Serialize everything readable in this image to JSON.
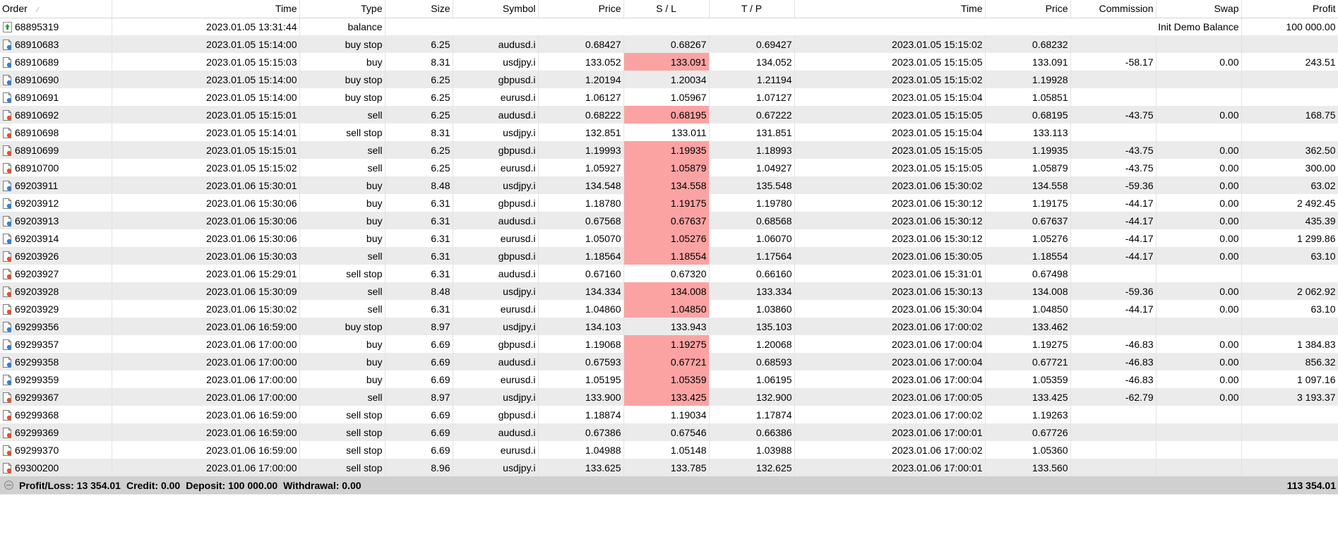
{
  "columns": [
    "Order",
    "Time",
    "Type",
    "Size",
    "Symbol",
    "Price",
    "S / L",
    "T / P",
    "Time",
    "Price",
    "Commission",
    "Swap",
    "Profit"
  ],
  "balance_row": {
    "order": "68895319",
    "time": "2023.01.05 13:31:44",
    "type": "balance",
    "comment": "Init Demo Balance",
    "profit": "100 000.00",
    "icon": "deposit-icon"
  },
  "rows": [
    {
      "order": "68910683",
      "time": "2023.01.05 15:14:00",
      "type": "buy stop",
      "size": "6.25",
      "symbol": "audusd.i",
      "price": "0.68427",
      "sl": "0.68267",
      "tp": "0.69427",
      "close_time": "2023.01.05 15:15:02",
      "close_price": "0.68232",
      "commission": "",
      "swap": "",
      "profit": "",
      "sl_hit": false,
      "side": "buy"
    },
    {
      "order": "68910689",
      "time": "2023.01.05 15:15:03",
      "type": "buy",
      "size": "8.31",
      "symbol": "usdjpy.i",
      "price": "133.052",
      "sl": "133.091",
      "tp": "134.052",
      "close_time": "2023.01.05 15:15:05",
      "close_price": "133.091",
      "commission": "-58.17",
      "swap": "0.00",
      "profit": "243.51",
      "sl_hit": true,
      "side": "buy"
    },
    {
      "order": "68910690",
      "time": "2023.01.05 15:14:00",
      "type": "buy stop",
      "size": "6.25",
      "symbol": "gbpusd.i",
      "price": "1.20194",
      "sl": "1.20034",
      "tp": "1.21194",
      "close_time": "2023.01.05 15:15:02",
      "close_price": "1.19928",
      "commission": "",
      "swap": "",
      "profit": "",
      "sl_hit": false,
      "side": "buy"
    },
    {
      "order": "68910691",
      "time": "2023.01.05 15:14:00",
      "type": "buy stop",
      "size": "6.25",
      "symbol": "eurusd.i",
      "price": "1.06127",
      "sl": "1.05967",
      "tp": "1.07127",
      "close_time": "2023.01.05 15:15:04",
      "close_price": "1.05851",
      "commission": "",
      "swap": "",
      "profit": "",
      "sl_hit": false,
      "side": "buy"
    },
    {
      "order": "68910692",
      "time": "2023.01.05 15:15:01",
      "type": "sell",
      "size": "6.25",
      "symbol": "audusd.i",
      "price": "0.68222",
      "sl": "0.68195",
      "tp": "0.67222",
      "close_time": "2023.01.05 15:15:05",
      "close_price": "0.68195",
      "commission": "-43.75",
      "swap": "0.00",
      "profit": "168.75",
      "sl_hit": true,
      "side": "sell"
    },
    {
      "order": "68910698",
      "time": "2023.01.05 15:14:01",
      "type": "sell stop",
      "size": "8.31",
      "symbol": "usdjpy.i",
      "price": "132.851",
      "sl": "133.011",
      "tp": "131.851",
      "close_time": "2023.01.05 15:15:04",
      "close_price": "133.113",
      "commission": "",
      "swap": "",
      "profit": "",
      "sl_hit": false,
      "side": "sell"
    },
    {
      "order": "68910699",
      "time": "2023.01.05 15:15:01",
      "type": "sell",
      "size": "6.25",
      "symbol": "gbpusd.i",
      "price": "1.19993",
      "sl": "1.19935",
      "tp": "1.18993",
      "close_time": "2023.01.05 15:15:05",
      "close_price": "1.19935",
      "commission": "-43.75",
      "swap": "0.00",
      "profit": "362.50",
      "sl_hit": true,
      "side": "sell"
    },
    {
      "order": "68910700",
      "time": "2023.01.05 15:15:02",
      "type": "sell",
      "size": "6.25",
      "symbol": "eurusd.i",
      "price": "1.05927",
      "sl": "1.05879",
      "tp": "1.04927",
      "close_time": "2023.01.05 15:15:05",
      "close_price": "1.05879",
      "commission": "-43.75",
      "swap": "0.00",
      "profit": "300.00",
      "sl_hit": true,
      "side": "sell"
    },
    {
      "order": "69203911",
      "time": "2023.01.06 15:30:01",
      "type": "buy",
      "size": "8.48",
      "symbol": "usdjpy.i",
      "price": "134.548",
      "sl": "134.558",
      "tp": "135.548",
      "close_time": "2023.01.06 15:30:02",
      "close_price": "134.558",
      "commission": "-59.36",
      "swap": "0.00",
      "profit": "63.02",
      "sl_hit": true,
      "side": "buy"
    },
    {
      "order": "69203912",
      "time": "2023.01.06 15:30:06",
      "type": "buy",
      "size": "6.31",
      "symbol": "gbpusd.i",
      "price": "1.18780",
      "sl": "1.19175",
      "tp": "1.19780",
      "close_time": "2023.01.06 15:30:12",
      "close_price": "1.19175",
      "commission": "-44.17",
      "swap": "0.00",
      "profit": "2 492.45",
      "sl_hit": true,
      "side": "buy"
    },
    {
      "order": "69203913",
      "time": "2023.01.06 15:30:06",
      "type": "buy",
      "size": "6.31",
      "symbol": "audusd.i",
      "price": "0.67568",
      "sl": "0.67637",
      "tp": "0.68568",
      "close_time": "2023.01.06 15:30:12",
      "close_price": "0.67637",
      "commission": "-44.17",
      "swap": "0.00",
      "profit": "435.39",
      "sl_hit": true,
      "side": "buy"
    },
    {
      "order": "69203914",
      "time": "2023.01.06 15:30:06",
      "type": "buy",
      "size": "6.31",
      "symbol": "eurusd.i",
      "price": "1.05070",
      "sl": "1.05276",
      "tp": "1.06070",
      "close_time": "2023.01.06 15:30:12",
      "close_price": "1.05276",
      "commission": "-44.17",
      "swap": "0.00",
      "profit": "1 299.86",
      "sl_hit": true,
      "side": "buy"
    },
    {
      "order": "69203926",
      "time": "2023.01.06 15:30:03",
      "type": "sell",
      "size": "6.31",
      "symbol": "gbpusd.i",
      "price": "1.18564",
      "sl": "1.18554",
      "tp": "1.17564",
      "close_time": "2023.01.06 15:30:05",
      "close_price": "1.18554",
      "commission": "-44.17",
      "swap": "0.00",
      "profit": "63.10",
      "sl_hit": true,
      "side": "sell"
    },
    {
      "order": "69203927",
      "time": "2023.01.06 15:29:01",
      "type": "sell stop",
      "size": "6.31",
      "symbol": "audusd.i",
      "price": "0.67160",
      "sl": "0.67320",
      "tp": "0.66160",
      "close_time": "2023.01.06 15:31:01",
      "close_price": "0.67498",
      "commission": "",
      "swap": "",
      "profit": "",
      "sl_hit": false,
      "side": "sell"
    },
    {
      "order": "69203928",
      "time": "2023.01.06 15:30:09",
      "type": "sell",
      "size": "8.48",
      "symbol": "usdjpy.i",
      "price": "134.334",
      "sl": "134.008",
      "tp": "133.334",
      "close_time": "2023.01.06 15:30:13",
      "close_price": "134.008",
      "commission": "-59.36",
      "swap": "0.00",
      "profit": "2 062.92",
      "sl_hit": true,
      "side": "sell"
    },
    {
      "order": "69203929",
      "time": "2023.01.06 15:30:02",
      "type": "sell",
      "size": "6.31",
      "symbol": "eurusd.i",
      "price": "1.04860",
      "sl": "1.04850",
      "tp": "1.03860",
      "close_time": "2023.01.06 15:30:04",
      "close_price": "1.04850",
      "commission": "-44.17",
      "swap": "0.00",
      "profit": "63.10",
      "sl_hit": true,
      "side": "sell"
    },
    {
      "order": "69299356",
      "time": "2023.01.06 16:59:00",
      "type": "buy stop",
      "size": "8.97",
      "symbol": "usdjpy.i",
      "price": "134.103",
      "sl": "133.943",
      "tp": "135.103",
      "close_time": "2023.01.06 17:00:02",
      "close_price": "133.462",
      "commission": "",
      "swap": "",
      "profit": "",
      "sl_hit": false,
      "side": "buy"
    },
    {
      "order": "69299357",
      "time": "2023.01.06 17:00:00",
      "type": "buy",
      "size": "6.69",
      "symbol": "gbpusd.i",
      "price": "1.19068",
      "sl": "1.19275",
      "tp": "1.20068",
      "close_time": "2023.01.06 17:00:04",
      "close_price": "1.19275",
      "commission": "-46.83",
      "swap": "0.00",
      "profit": "1 384.83",
      "sl_hit": true,
      "side": "buy"
    },
    {
      "order": "69299358",
      "time": "2023.01.06 17:00:00",
      "type": "buy",
      "size": "6.69",
      "symbol": "audusd.i",
      "price": "0.67593",
      "sl": "0.67721",
      "tp": "0.68593",
      "close_time": "2023.01.06 17:00:04",
      "close_price": "0.67721",
      "commission": "-46.83",
      "swap": "0.00",
      "profit": "856.32",
      "sl_hit": true,
      "side": "buy"
    },
    {
      "order": "69299359",
      "time": "2023.01.06 17:00:00",
      "type": "buy",
      "size": "6.69",
      "symbol": "eurusd.i",
      "price": "1.05195",
      "sl": "1.05359",
      "tp": "1.06195",
      "close_time": "2023.01.06 17:00:04",
      "close_price": "1.05359",
      "commission": "-46.83",
      "swap": "0.00",
      "profit": "1 097.16",
      "sl_hit": true,
      "side": "buy"
    },
    {
      "order": "69299367",
      "time": "2023.01.06 17:00:00",
      "type": "sell",
      "size": "8.97",
      "symbol": "usdjpy.i",
      "price": "133.900",
      "sl": "133.425",
      "tp": "132.900",
      "close_time": "2023.01.06 17:00:05",
      "close_price": "133.425",
      "commission": "-62.79",
      "swap": "0.00",
      "profit": "3 193.37",
      "sl_hit": true,
      "side": "sell"
    },
    {
      "order": "69299368",
      "time": "2023.01.06 16:59:00",
      "type": "sell stop",
      "size": "6.69",
      "symbol": "gbpusd.i",
      "price": "1.18874",
      "sl": "1.19034",
      "tp": "1.17874",
      "close_time": "2023.01.06 17:00:02",
      "close_price": "1.19263",
      "commission": "",
      "swap": "",
      "profit": "",
      "sl_hit": false,
      "side": "sell"
    },
    {
      "order": "69299369",
      "time": "2023.01.06 16:59:00",
      "type": "sell stop",
      "size": "6.69",
      "symbol": "audusd.i",
      "price": "0.67386",
      "sl": "0.67546",
      "tp": "0.66386",
      "close_time": "2023.01.06 17:00:01",
      "close_price": "0.67726",
      "commission": "",
      "swap": "",
      "profit": "",
      "sl_hit": false,
      "side": "sell"
    },
    {
      "order": "69299370",
      "time": "2023.01.06 16:59:00",
      "type": "sell stop",
      "size": "6.69",
      "symbol": "eurusd.i",
      "price": "1.04988",
      "sl": "1.05148",
      "tp": "1.03988",
      "close_time": "2023.01.06 17:00:02",
      "close_price": "1.05360",
      "commission": "",
      "swap": "",
      "profit": "",
      "sl_hit": false,
      "side": "sell"
    },
    {
      "order": "69300200",
      "time": "2023.01.06 17:00:00",
      "type": "sell stop",
      "size": "8.96",
      "symbol": "usdjpy.i",
      "price": "133.625",
      "sl": "133.785",
      "tp": "132.625",
      "close_time": "2023.01.06 17:00:01",
      "close_price": "133.560",
      "commission": "",
      "swap": "",
      "profit": "",
      "sl_hit": false,
      "side": "sell"
    }
  ],
  "summary": {
    "profit_loss": "Profit/Loss: 13 354.01",
    "credit": "Credit: 0.00",
    "deposit": "Deposit: 100 000.00",
    "withdrawal": "Withdrawal: 0.00",
    "total": "113 354.01"
  },
  "colors": {
    "sl_hit_bg": "#fba3a3",
    "alt_row_bg": "#ebebeb",
    "summary_bg": "#d0d0d0",
    "buy_dot": "#2f7fd8",
    "sell_dot": "#e0512d",
    "deposit_green": "#2e9a3a"
  }
}
